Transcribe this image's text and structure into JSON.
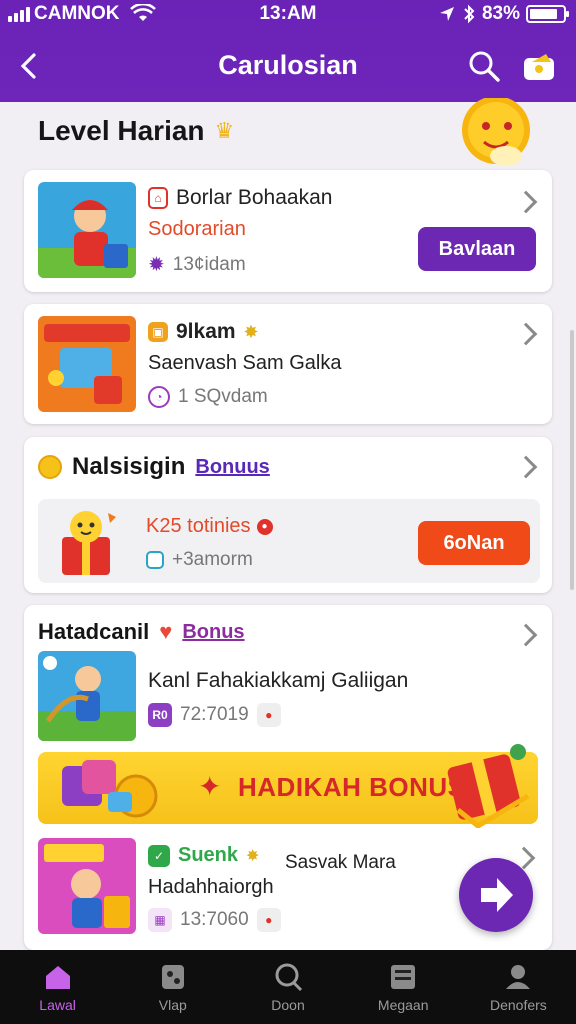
{
  "status_bar": {
    "carrier": "CAMNOK",
    "time": "13:AM",
    "battery": "83%",
    "battery_level": 0.83
  },
  "header": {
    "title": "Carulosian"
  },
  "section": {
    "title": "Level Harian"
  },
  "item1": {
    "title": "Borlar Bohaakan",
    "subtitle": "Sodorarian",
    "meta": "13¢idam",
    "button": "Bavlaan"
  },
  "item2": {
    "title": "9lkam",
    "subtitle": "Saenvash Sam Galka",
    "meta": "1 SQvdam"
  },
  "promo": {
    "title": "Nalsisigin",
    "link": "Bonuus",
    "reward": "K25 totinies",
    "meta": "+3amorm",
    "button": "6oNan"
  },
  "feed": {
    "title": "Hatadcanil",
    "link": "Bonus",
    "item1": {
      "title": "Kanl Fahakiakkamj Galiigan",
      "badge": "R0",
      "meta": "72:7019"
    },
    "banner": "HADIKAH BONUS",
    "item2": {
      "tag": "Suenk",
      "title": "Sasvak Mara",
      "subtitle": "Hadahhaiorgh",
      "meta": "13:7060"
    }
  },
  "tabs": [
    {
      "label": "Lawal",
      "icon": "home-icon",
      "active": true
    },
    {
      "label": "Vlap",
      "icon": "game-icon",
      "active": false
    },
    {
      "label": "Doon",
      "icon": "search-icon",
      "active": false
    },
    {
      "label": "Megaan",
      "icon": "box-icon",
      "active": false
    },
    {
      "label": "Denofers",
      "icon": "user-icon",
      "active": false
    }
  ],
  "colors": {
    "primary": "#6c27b3",
    "accent": "#f04a18",
    "banner": "#ffd431"
  }
}
